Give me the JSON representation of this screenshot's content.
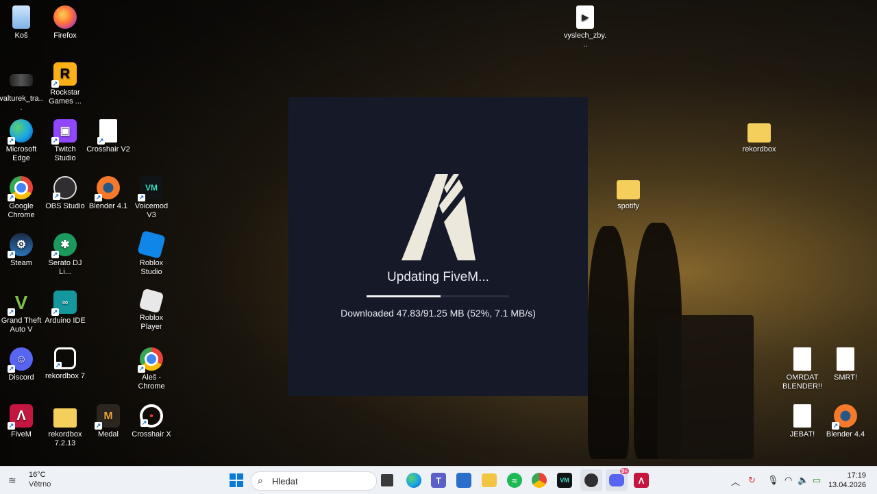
{
  "desktop": {
    "icons": [
      {
        "label": "Koš",
        "kind": "recycle-bin"
      },
      {
        "label": "Firefox",
        "kind": "firefox"
      },
      {
        "label": "vyslech_zby...",
        "kind": "video-file"
      },
      {
        "label": "valturek_tra...",
        "kind": "image"
      },
      {
        "label": "Rockstar Games ...",
        "kind": "rockstar"
      },
      {
        "label": "Microsoft Edge",
        "kind": "edge"
      },
      {
        "label": "Twitch Studio",
        "kind": "twitch"
      },
      {
        "label": "Crosshair V2",
        "kind": "file"
      },
      {
        "label": "rekordbox",
        "kind": "folder"
      },
      {
        "label": "Google Chrome",
        "kind": "chrome"
      },
      {
        "label": "OBS Studio",
        "kind": "obs"
      },
      {
        "label": "Blender 4.1",
        "kind": "blender"
      },
      {
        "label": "Voicemod V3",
        "kind": "voicemod"
      },
      {
        "label": "spotify",
        "kind": "folder"
      },
      {
        "label": "Steam",
        "kind": "steam"
      },
      {
        "label": "Serato DJ Li...",
        "kind": "serato"
      },
      {
        "label": "Roblox Studio",
        "kind": "roblox-studio"
      },
      {
        "label": "Grand Theft Auto V",
        "kind": "gta"
      },
      {
        "label": "Arduino IDE",
        "kind": "arduino"
      },
      {
        "label": "Roblox Player",
        "kind": "roblox"
      },
      {
        "label": "Discord",
        "kind": "discord"
      },
      {
        "label": "rekordbox 7",
        "kind": "rekordbox"
      },
      {
        "label": "Aleš - Chrome",
        "kind": "chrome-profile"
      },
      {
        "label": "OMRDAT BLENDER!!",
        "kind": "file"
      },
      {
        "label": "SMRT!",
        "kind": "file"
      },
      {
        "label": "FiveM",
        "kind": "fivem"
      },
      {
        "label": "rekordbox 7.2.13",
        "kind": "folder"
      },
      {
        "label": "Medal",
        "kind": "medal"
      },
      {
        "label": "Crosshair X",
        "kind": "crosshair"
      },
      {
        "label": "JEBAT!",
        "kind": "file"
      },
      {
        "label": "Blender 4.4",
        "kind": "blender"
      }
    ]
  },
  "dialog": {
    "title": "Updating FiveM...",
    "status": "Downloaded 47.83/91.25 MB (52%, 7.1 MB/s)",
    "progress": 0.52
  },
  "taskbar": {
    "weather_temp": "16°C",
    "weather_desc": "Větrno",
    "search_placeholder": "Hledat",
    "pinned": [
      "start-icon",
      "task-view-icon",
      "edge-icon",
      "teams-icon",
      "store-icon",
      "explorer-icon",
      "spotify-icon",
      "chrome-icon",
      "voicemod-icon",
      "obs-icon",
      "discord-icon",
      "fivem-icon"
    ],
    "discord_badge": "9+",
    "time": "17:19",
    "date": "13.04.2026"
  },
  "colors": {
    "dialog_bg": "#161a28",
    "progress_fill": "#f3f3f3",
    "taskbar_bg": "#eef1f6"
  }
}
